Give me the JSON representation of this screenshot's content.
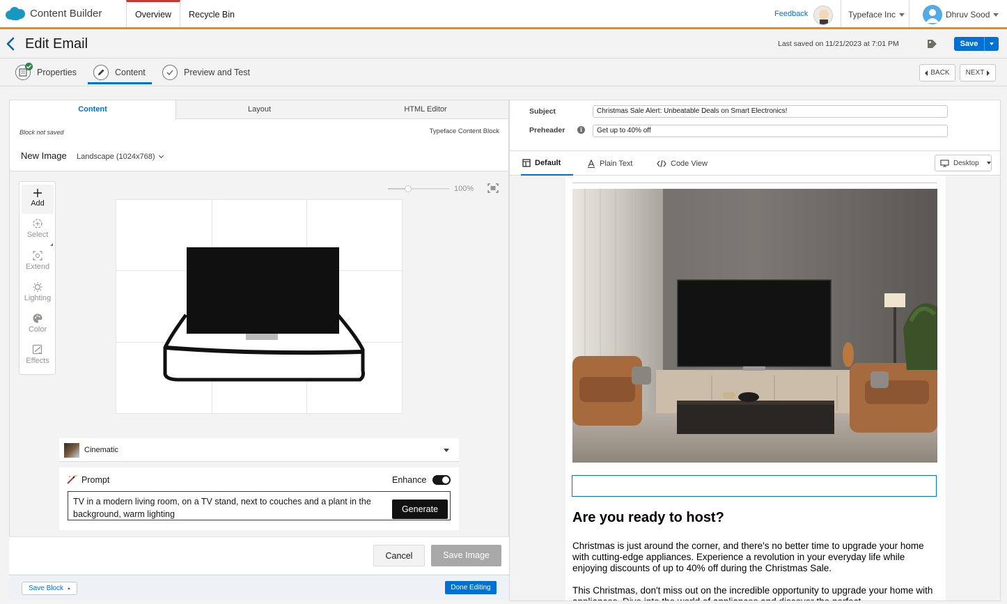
{
  "app": {
    "brand_name": "Content Builder",
    "tabs": [
      "Overview",
      "Recycle Bin"
    ],
    "feedback_label": "Feedback",
    "org_name": "Typeface Inc",
    "user_name": "Dhruv Sood",
    "accent_color": "#e58f1a"
  },
  "header": {
    "title": "Edit Email",
    "last_saved": "Last saved on 11/21/2023 at 7:01 PM",
    "save_label": "Save"
  },
  "steps": {
    "items": [
      "Properties",
      "Content",
      "Preview and Test"
    ],
    "active": "Content",
    "back_label": "BACK",
    "next_label": "NEXT"
  },
  "editor": {
    "tabs": [
      "Content",
      "Layout",
      "HTML Editor"
    ],
    "active_tab": "Content",
    "block_status": "Block not saved",
    "block_type": "Typeface Content Block",
    "title": "New Image",
    "size_option": "Landscape (1024x768)",
    "tools": [
      "Add",
      "Select",
      "Extend",
      "Lighting",
      "Color",
      "Effects"
    ],
    "active_tool": "Add",
    "zoom": "100%",
    "style": "Cinematic",
    "prompt_label": "Prompt",
    "enhance_label": "Enhance",
    "enhance_on": true,
    "prompt_text": "TV in a modern living room, on a TV stand, next to couches and a plant in the background, warm lighting",
    "generate_label": "Generate",
    "cancel_label": "Cancel",
    "save_image_label": "Save Image",
    "save_block_label": "Save Block",
    "done_label": "Done Editing"
  },
  "email": {
    "subject_label": "Subject",
    "subject": "Christmas Sale Alert: Unbeatable Deals on Smart Electronics!",
    "preheader_label": "Preheader",
    "preheader": "Get up to 40% off",
    "view_tabs": [
      "Default",
      "Plain Text",
      "Code View"
    ],
    "active_view": "Default",
    "device": "Desktop",
    "heading": "Are you ready to host?",
    "para1": "Christmas is just around the corner, and there's no better time to upgrade your home with cutting-edge appliances. Experience a revolution in your everyday life while enjoying discounts of up to 40% off during the Christmas Sale.",
    "para2": "This Christmas, don't miss out on the incredible opportunity to upgrade your home with appliances. Dive into the world of appliances and discover the perfect"
  }
}
